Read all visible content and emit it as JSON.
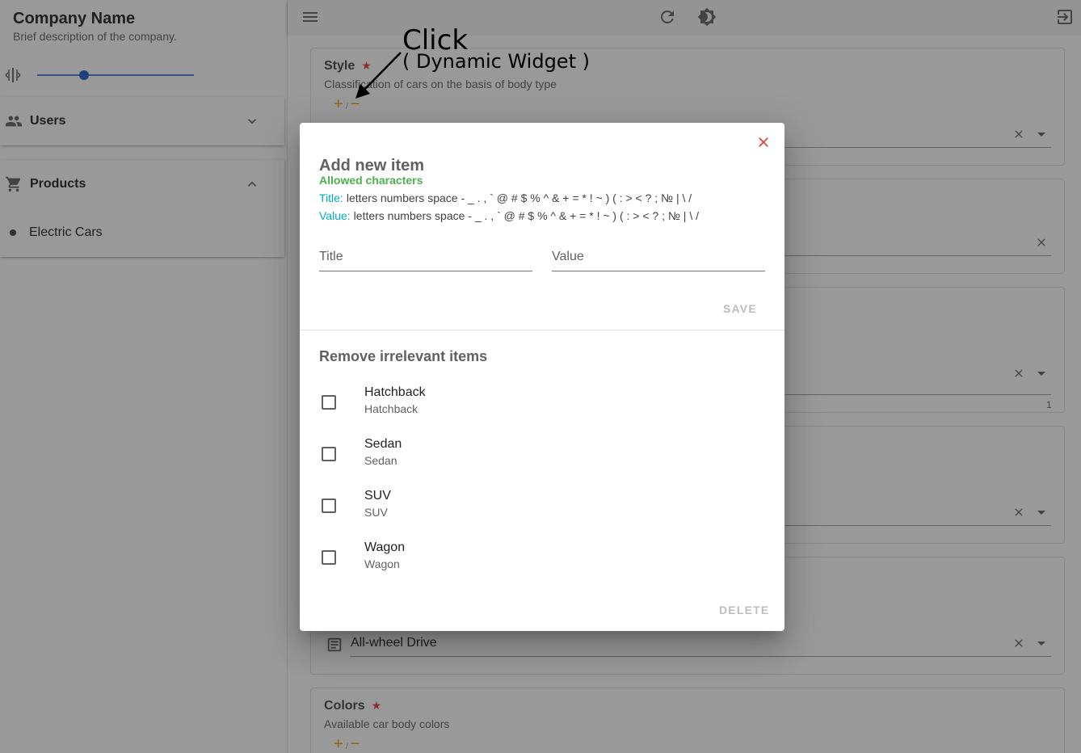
{
  "sidebar": {
    "company_name": "Company Name",
    "company_description": "Brief description of the company.",
    "width_slider_value": 0.3,
    "groups": [
      {
        "label": "Users",
        "icon": "people-icon",
        "expanded": false
      },
      {
        "label": "Products",
        "icon": "cart-icon",
        "expanded": true,
        "items": [
          {
            "label": "Electric Cars"
          }
        ]
      }
    ]
  },
  "topbar": {
    "icons": [
      "menu-icon",
      "refresh-icon",
      "brightness-icon",
      "logout-icon"
    ]
  },
  "background_form": {
    "style_card": {
      "title": "Style",
      "required": true,
      "description": "Classification of cars on the basis of body type"
    },
    "drive_field_value": "All-wheel Drive",
    "counter_value": "1",
    "colors_card": {
      "title": "Colors",
      "required": true,
      "description": "Available car body colors"
    },
    "add_remove_separator": "/"
  },
  "annotation": {
    "line1": "Click",
    "line2": "( Dynamic Widget )"
  },
  "dialog": {
    "add_title": "Add new item",
    "allowed_label": "Allowed characters",
    "title_rule_key": "Title:",
    "title_rule_text": "letters numbers space - _ . , ` @ # $ % ^ & + = * ! ~ ) ( : > < ? ; № | \\ /",
    "value_rule_key": "Value:",
    "value_rule_text": "letters numbers space - _ . , ` @ # $ % ^ & + = * ! ~ ) ( : > < ? ; № | \\ /",
    "title_input": {
      "placeholder": "Title",
      "value": ""
    },
    "value_input": {
      "placeholder": "Value",
      "value": ""
    },
    "save_label": "SAVE",
    "remove_title": "Remove irrelevant items",
    "items": [
      {
        "title": "Hatchback",
        "value": "Hatchback",
        "checked": false
      },
      {
        "title": "Sedan",
        "value": "Sedan",
        "checked": false
      },
      {
        "title": "SUV",
        "value": "SUV",
        "checked": false
      },
      {
        "title": "Wagon",
        "value": "Wagon",
        "checked": false
      }
    ],
    "delete_label": "DELETE"
  },
  "colors": {
    "accent_orange": "#f29f05",
    "required_red": "#e53935",
    "allowed_green": "#4caf50",
    "rule_key_cyan": "#00acc1",
    "slider_blue": "#1e5bc6",
    "close_red": "#e53935"
  }
}
